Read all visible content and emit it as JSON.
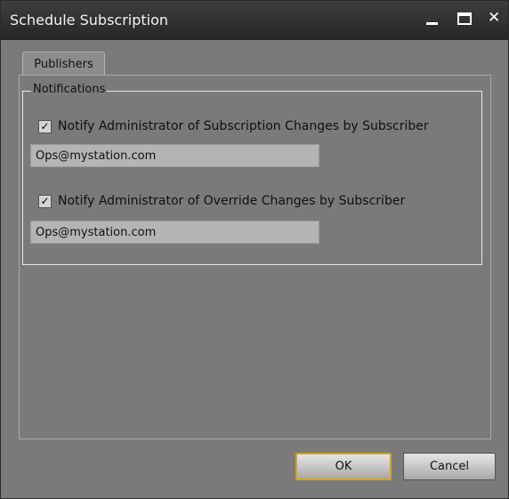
{
  "window": {
    "title": "Schedule Subscription"
  },
  "tabs": [
    {
      "label": "Publishers"
    }
  ],
  "notifications": {
    "group_title": "Notifications",
    "subscription": {
      "label": "Notify Administrator of Subscription Changes by Subscriber",
      "checked": true,
      "email": "Ops@mystation.com"
    },
    "override": {
      "label": "Notify Administrator of Override Changes by Subscriber",
      "checked": true,
      "email": "Ops@mystation.com"
    }
  },
  "buttons": {
    "ok": "OK",
    "cancel": "Cancel"
  },
  "icons": {
    "close": "✕",
    "check": "✓"
  },
  "colors": {
    "window_bg": "#7a7a7a",
    "titlebar": "#2e2e2e",
    "ok_focus_border": "#d4a520"
  }
}
